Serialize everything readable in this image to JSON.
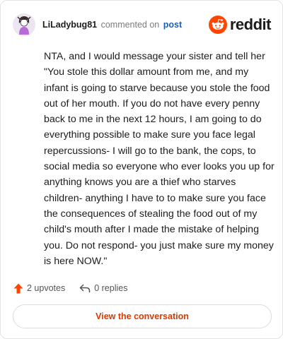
{
  "header": {
    "username": "LiLadybug81",
    "commented_text": "commented on",
    "post_link": "post",
    "brand_name": "reddit",
    "avatar_icon": "user-avatar-icon",
    "brand_icon": "reddit-alien-icon"
  },
  "comment": {
    "body": "NTA, and I would message your sister and tell her \"You stole this dollar amount from me, and my infant is going to starve because you stole the food out of her mouth. If you do not have every penny back to me in the next 12 hours, I am going to do everything possible to make sure you face legal repercussions- I will go to the bank, the cops, to social media so everyone who ever looks you up for anything knows you are a thief who starves children- anything I have to to make sure you face the consequences of stealing the food out of my child's mouth after I made the mistake of helping you. Do not respond- you just make sure my money is here NOW.\""
  },
  "footer": {
    "upvotes": "2 upvotes",
    "replies": "0 replies",
    "upvote_icon": "upvote-arrow-icon",
    "reply_icon": "reply-arrow-icon"
  },
  "cta": {
    "label": "View the conversation"
  },
  "colors": {
    "accent": "#d93a00",
    "reddit_orange": "#ff4500",
    "link": "#1d5fb8"
  }
}
